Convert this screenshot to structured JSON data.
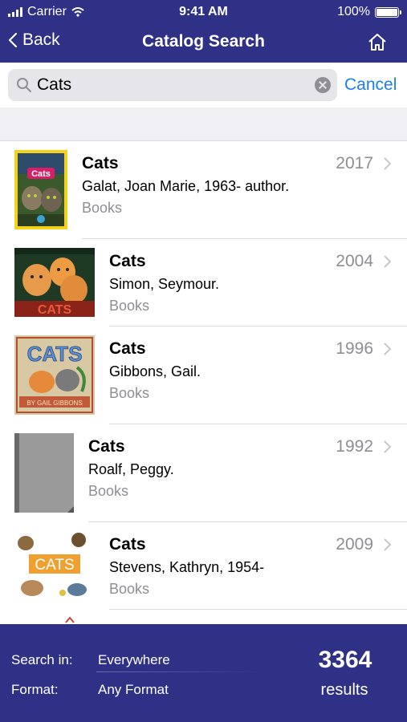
{
  "status_bar": {
    "carrier": "Carrier",
    "time": "9:41 AM",
    "battery_percent": "100%",
    "icons": [
      "signal-icon",
      "wifi-icon",
      "battery-icon"
    ]
  },
  "nav": {
    "back_label": "Back",
    "title": "Catalog Search",
    "home_icon": "home-icon"
  },
  "search": {
    "value": "Cats",
    "cancel_label": "Cancel"
  },
  "results": [
    {
      "title": "Cats",
      "author": "Galat, Joan Marie, 1963- author.",
      "type": "Books",
      "year": "2017"
    },
    {
      "title": "Cats",
      "author": "Simon, Seymour.",
      "type": "Books",
      "year": "2004"
    },
    {
      "title": "Cats",
      "author": "Gibbons, Gail.",
      "type": "Books",
      "year": "1996"
    },
    {
      "title": "Cats",
      "author": "Roalf, Peggy.",
      "type": "Books",
      "year": "1992"
    },
    {
      "title": "Cats",
      "author": "Stevens, Kathryn, 1954-",
      "type": "Books",
      "year": "2009"
    }
  ],
  "covers": {
    "cover_1_text": "Cats",
    "cover_2_text": "CATS",
    "cover_3_text": "CATS",
    "cover_3_byline": "BY GAIL GIBBONS",
    "cover_5_text": "CATS"
  },
  "footer": {
    "search_in_label": "Search in:",
    "search_in_value": "Everywhere",
    "format_label": "Format:",
    "format_value": "Any Format",
    "count": "3364",
    "results_label": "results"
  },
  "colors": {
    "bar_bg": "#2e3185",
    "accent": "#1a7ef0",
    "secondary_text": "#8e8e93"
  }
}
